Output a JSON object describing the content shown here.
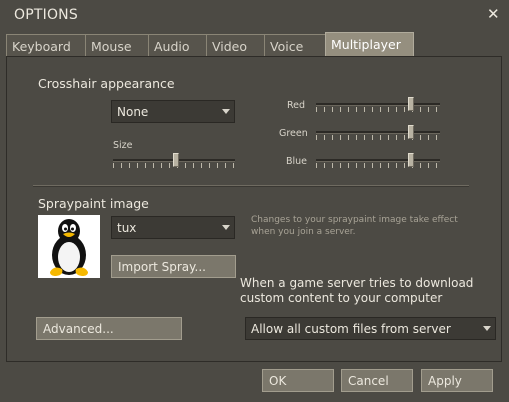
{
  "window": {
    "title": "OPTIONS",
    "close_glyph": "✕"
  },
  "tabs": [
    {
      "label": "Keyboard",
      "active": false
    },
    {
      "label": "Mouse",
      "active": false
    },
    {
      "label": "Audio",
      "active": false
    },
    {
      "label": "Video",
      "active": false
    },
    {
      "label": "Voice",
      "active": false
    },
    {
      "label": "Multiplayer",
      "active": true
    }
  ],
  "crosshair": {
    "label": "Crosshair appearance",
    "style_value": "None",
    "size_label": "Size",
    "size_level": 0.52,
    "red_label": "Red",
    "red_level": 0.78,
    "green_label": "Green",
    "green_level": 0.78,
    "blue_label": "Blue",
    "blue_level": 0.78
  },
  "spray": {
    "label": "Spraypaint image",
    "value": "tux",
    "hint": "Changes to your spraypaint image take effect when you join a server.",
    "import_button": "Import Spray..."
  },
  "download": {
    "label": "When a game server tries to download custom content to your computer",
    "value": "Allow all custom files from server"
  },
  "advanced_button": "Advanced...",
  "footer": {
    "ok": "OK",
    "cancel": "Cancel",
    "apply": "Apply"
  },
  "colors": {
    "background": "#4c4a44",
    "active_tab": "#958f7f",
    "button": "#7b776b",
    "combo": "#3c3a35"
  }
}
